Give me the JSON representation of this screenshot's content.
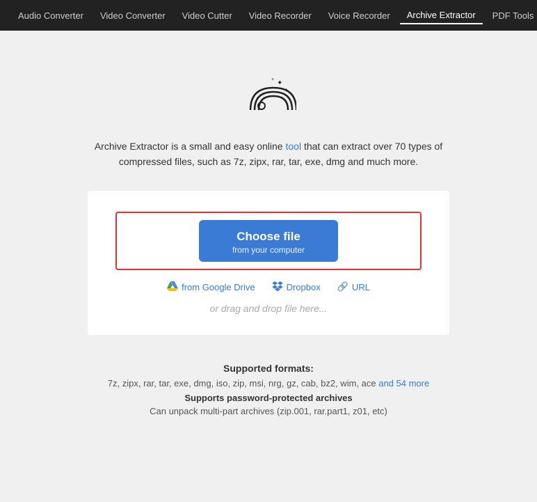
{
  "nav": {
    "items": [
      {
        "label": "Audio Converter",
        "active": false
      },
      {
        "label": "Video Converter",
        "active": false
      },
      {
        "label": "Video Cutter",
        "active": false
      },
      {
        "label": "Video Recorder",
        "active": false
      },
      {
        "label": "Voice Recorder",
        "active": false
      },
      {
        "label": "Archive Extractor",
        "active": true
      },
      {
        "label": "PDF Tools",
        "active": false
      }
    ]
  },
  "hero": {
    "description_part1": "Archive Extractor is a small and easy online tool",
    "description_part2": " that can extract over 70 types of",
    "description_line2": "compressed files, such as 7z, zipx, rar, tar, exe, dmg and much more."
  },
  "upload": {
    "choose_file_label": "Choose file",
    "choose_file_sublabel": "from your computer",
    "google_drive_label": "from Google Drive",
    "dropbox_label": "Dropbox",
    "url_label": "URL",
    "drag_drop_label": "or drag and drop file here..."
  },
  "formats": {
    "title": "Supported formats:",
    "list": "7z, zipx, rar, tar, exe, dmg, iso, zip, msi, nrg, gz, cab, bz2, wim, ace",
    "more_label": "and 54 more",
    "feature1": "Supports password-protected archives",
    "feature2": "Can unpack multi-part archives (zip.001, rar.part1, z01, etc)"
  }
}
